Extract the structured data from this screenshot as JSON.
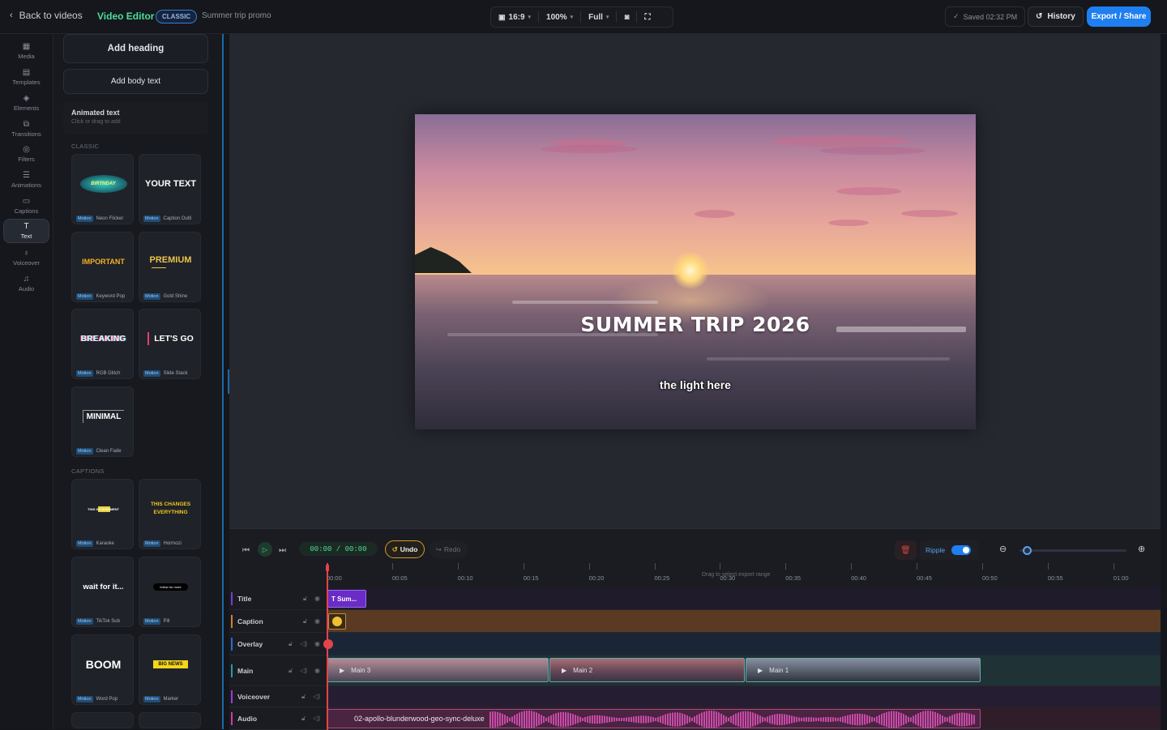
{
  "topbar": {
    "back_label": "Back to videos",
    "app_title": "Video Editor",
    "mode_badge": "CLASSIC",
    "project_name": "Summer trip promo",
    "aspect": "16:9",
    "zoom": "100%",
    "quality": "Full",
    "saved": "Saved 02:32 PM",
    "history_label": "History",
    "export_label": "Export / Share"
  },
  "rail": [
    {
      "label": "Media",
      "icon": "film-icon"
    },
    {
      "label": "Templates",
      "icon": "templates-icon"
    },
    {
      "label": "Elements",
      "icon": "layers-icon"
    },
    {
      "label": "Transitions",
      "icon": "transitions-icon"
    },
    {
      "label": "Filters",
      "icon": "filters-icon"
    },
    {
      "label": "Animations",
      "icon": "sliders-icon"
    },
    {
      "label": "Captions",
      "icon": "captions-icon"
    },
    {
      "label": "Text",
      "icon": "text-icon"
    },
    {
      "label": "Voiceover",
      "icon": "mic-icon"
    },
    {
      "label": "Audio",
      "icon": "music-icon"
    }
  ],
  "panel": {
    "add_heading": "Add heading",
    "add_body": "Add body text",
    "animated_title": "Animated text",
    "animated_sub": "Click or drag to add",
    "classic_label": "CLASSIC",
    "captions_label": "CAPTIONS",
    "motion_tag": "Motion",
    "classic_cards": [
      {
        "preview": "BIRTHDAY",
        "name": "Neon Flicker"
      },
      {
        "preview": "YOUR TEXT",
        "name": "Caption Outli"
      },
      {
        "preview": "IMPORTANT",
        "name": "Keyword Pop"
      },
      {
        "preview": "PREMIUM",
        "name": "Gold Shine"
      },
      {
        "preview": "BREAKING",
        "name": "RGB Glitch"
      },
      {
        "preview": "LET'S GO",
        "name": "Slide Stack"
      },
      {
        "preview": "MINIMAL",
        "name": "Clean Fade"
      }
    ],
    "caption_cards": [
      {
        "preview": "THIS GOVERNMENT",
        "name": "Karaoke"
      },
      {
        "preview": "THIS CHANGES EVERYTHING",
        "name": "Hormozi"
      },
      {
        "preview": "wait for it...",
        "name": "TikTok Sub"
      },
      {
        "preview": "follow for more",
        "name": "Pill"
      },
      {
        "preview": "BOOM",
        "name": "Word Pop"
      },
      {
        "preview": "BIG NEWS",
        "name": "Marker"
      }
    ]
  },
  "preview": {
    "title_text": "SUMMER TRIP 2026",
    "caption_text": "the light here"
  },
  "timeline": {
    "timecode": "00:00 / 00:00",
    "undo_label": "Undo",
    "redo_label": "Redo",
    "ripple_label": "Ripple",
    "ripple_on": true,
    "zoom_level": 0.03,
    "drag_hint": "Drag to select export range",
    "ruler": [
      "00:00",
      "00:05",
      "00:10",
      "00:15",
      "00:20",
      "00:25",
      "00:30",
      "00:35",
      "00:40",
      "00:45",
      "00:50",
      "00:55",
      "01:00"
    ],
    "tracks": [
      {
        "name": "Title",
        "color": "#7a3bd6"
      },
      {
        "name": "Caption",
        "color": "#d4802a"
      },
      {
        "name": "Overlay",
        "color": "#2a6bd4"
      },
      {
        "name": "Main",
        "color": "#2a9aa0"
      },
      {
        "name": "Voiceover",
        "color": "#9a3bd6"
      },
      {
        "name": "Audio",
        "color": "#d43b9a"
      }
    ],
    "title_clip": "T Sum...",
    "main_clips": [
      "Main 3",
      "Main 2",
      "Main 1"
    ],
    "audio_clip": "02-apollo-blunderwood-geo-sync-deluxe"
  }
}
